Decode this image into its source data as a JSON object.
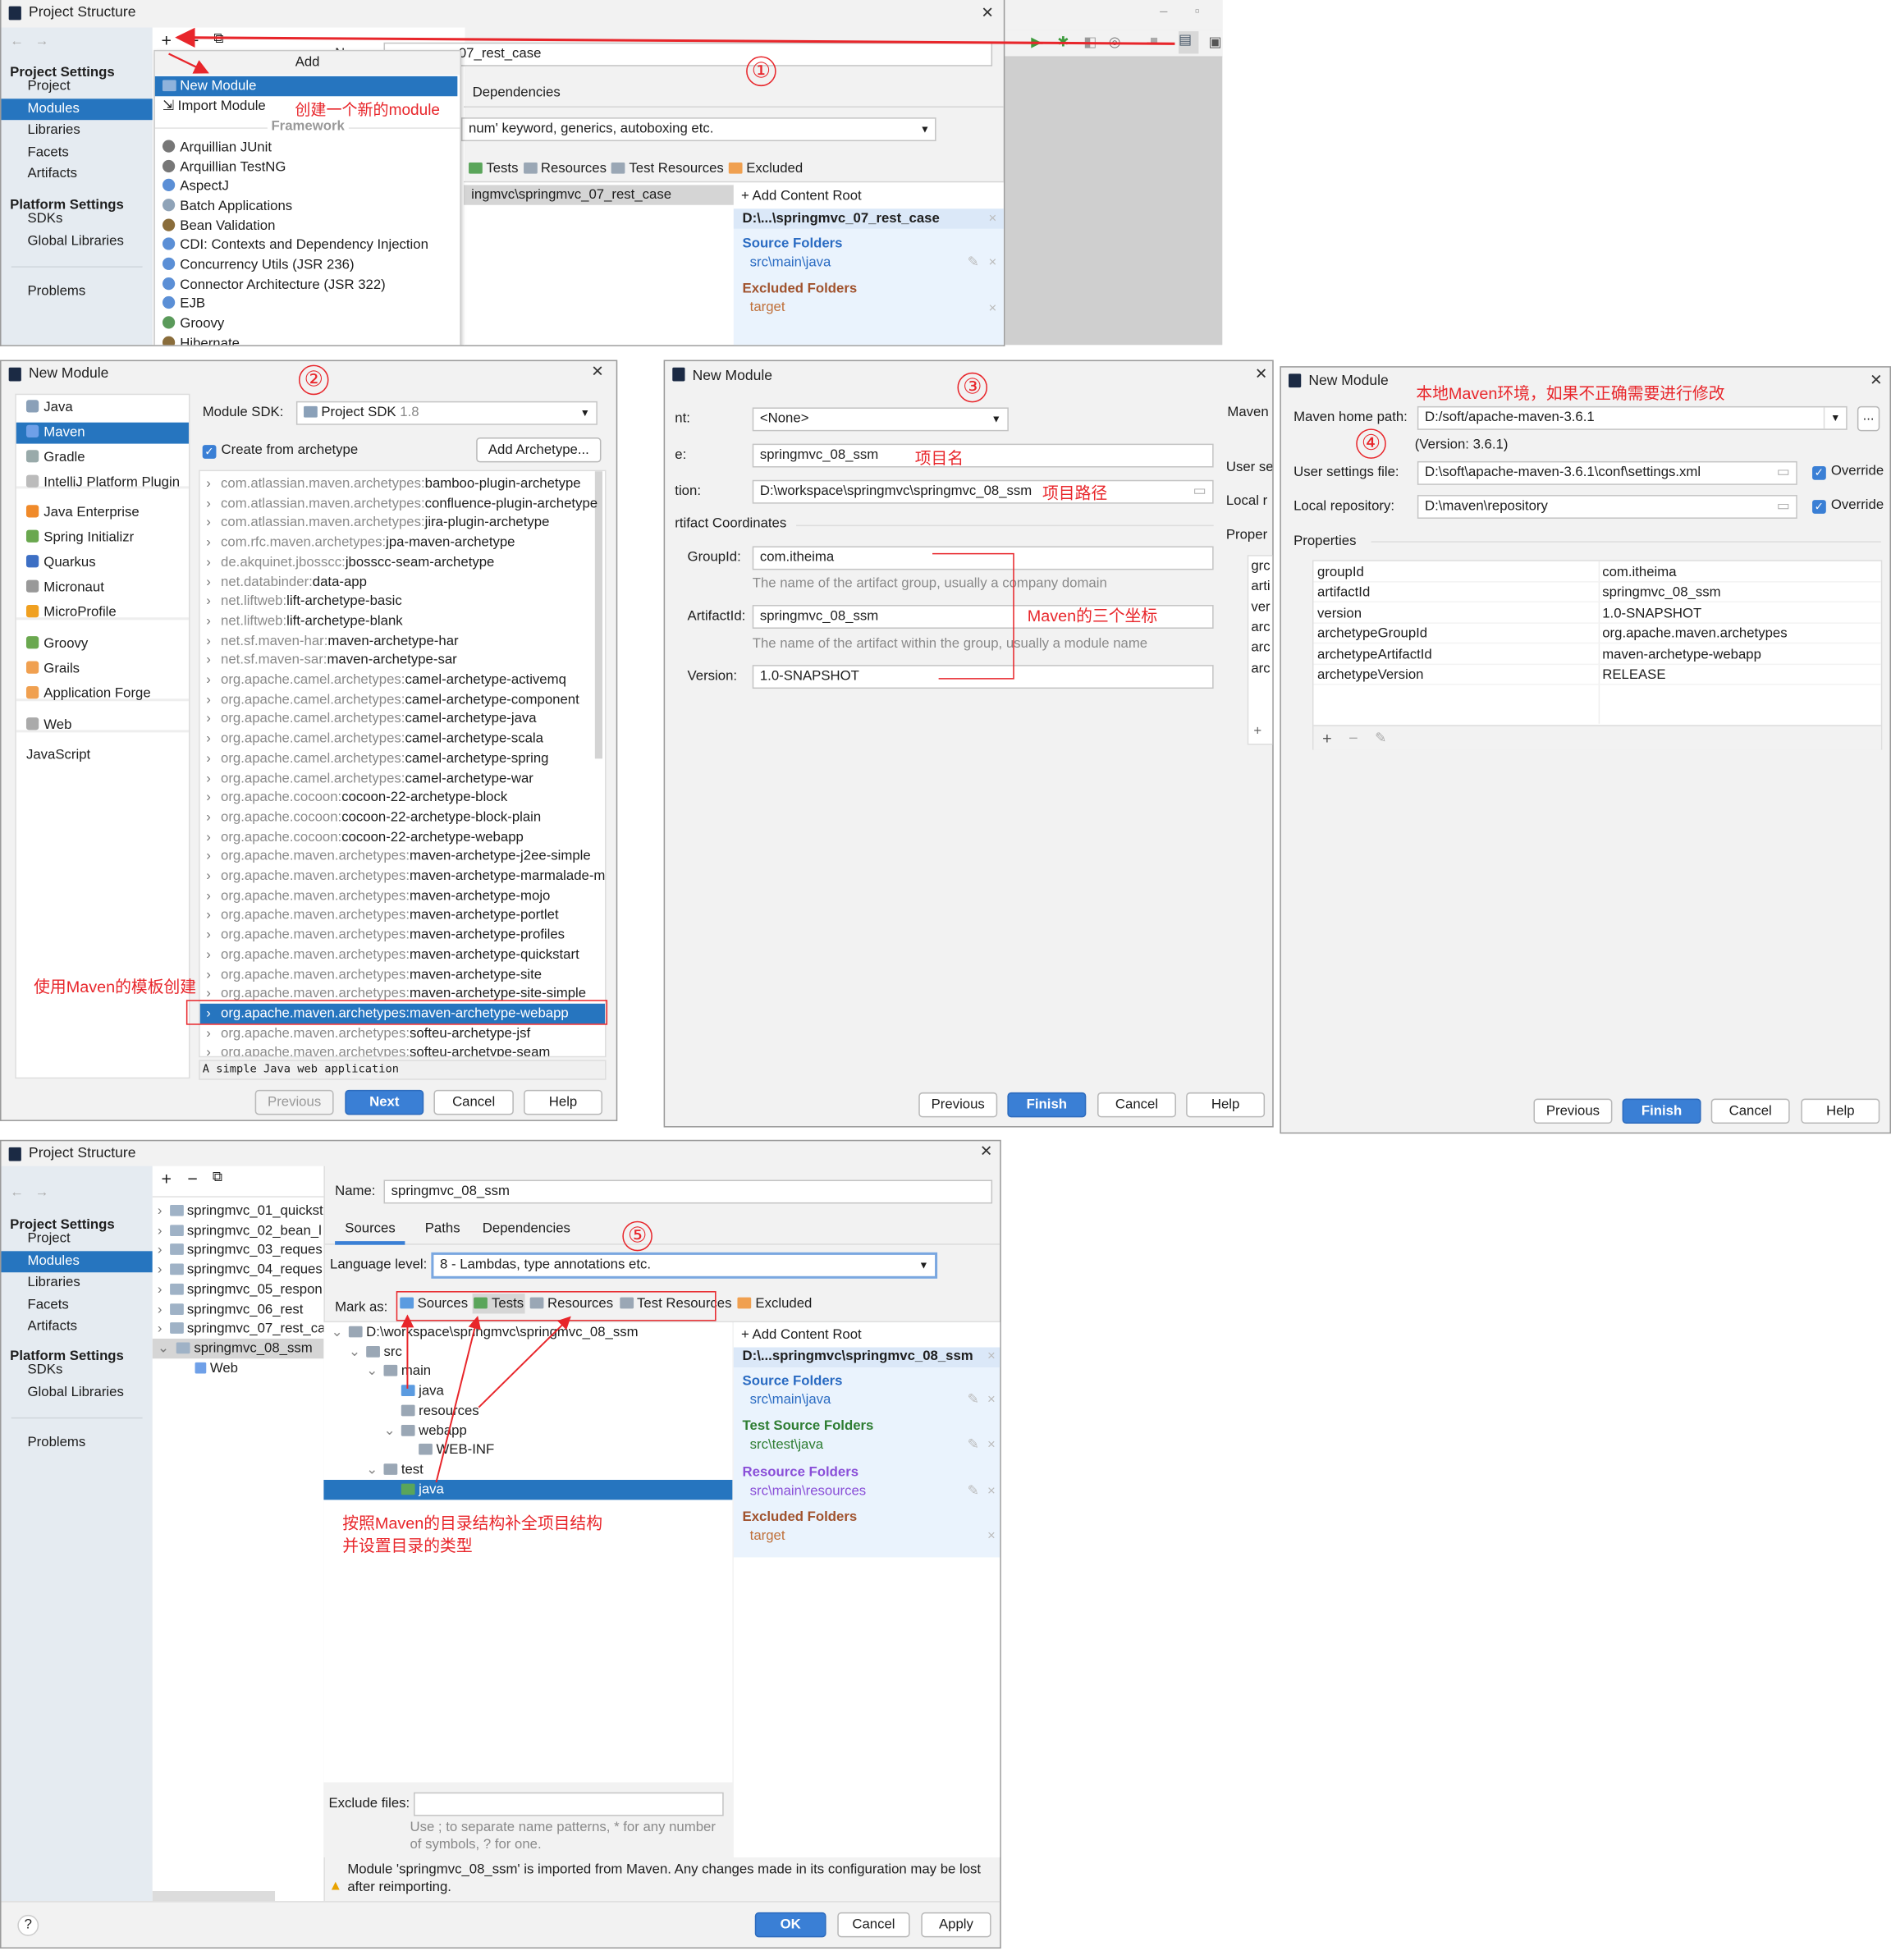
{
  "colors": {
    "selection": "#2675bf",
    "annotation": "#e8262b",
    "source": "#2a6bc2",
    "test": "#2e7d32",
    "resource": "#8a4fd8",
    "excluded": "#a0522d"
  },
  "sidebar": {
    "project_settings": "Project Settings",
    "items": [
      "Project",
      "Modules",
      "Libraries",
      "Facets",
      "Artifacts"
    ],
    "platform_settings": "Platform Settings",
    "platform_items": [
      "SDKs",
      "Global Libraries"
    ],
    "problems": "Problems"
  },
  "p1": {
    "title": "Project Structure",
    "step": "①",
    "name_value": "07_rest_case",
    "add_popup": {
      "header": "Add",
      "new_module": "New Module",
      "import_module": "Import Module",
      "framework": "Framework",
      "items": [
        "Arquillian JUnit",
        "Arquillian TestNG",
        "AspectJ",
        "Batch Applications",
        "Bean Validation",
        "CDI: Contexts and Dependency Injection",
        "Concurrency Utils (JSR 236)",
        "Connector Architecture (JSR 322)",
        "EJB",
        "Groovy",
        "Hibernate"
      ]
    },
    "annotation": "创建一个新的module",
    "dependencies_tab": "Dependencies",
    "language_level": "num' keyword, generics, autoboxing etc.",
    "mark_as": [
      "Tests",
      "Resources",
      "Test Resources",
      "Excluded"
    ],
    "tree_row": "ingmvc\\springmvc_07_rest_case",
    "content": {
      "add": "Add Content Root",
      "root": "D:\\...\\springmvc_07_rest_case",
      "source_folders": "Source Folders",
      "source_path": "src\\main\\java",
      "excluded_folders": "Excluded Folders",
      "excluded_path": "target"
    }
  },
  "p2": {
    "title": "New Module",
    "step": "②",
    "types": [
      "Java",
      "Maven",
      "Gradle",
      "IntelliJ Platform Plugin",
      "Java Enterprise",
      "Spring Initializr",
      "Quarkus",
      "Micronaut",
      "MicroProfile",
      "Groovy",
      "Grails",
      "Application Forge",
      "Web",
      "JavaScript"
    ],
    "sdk_label": "Module SDK:",
    "sdk_value": "Project SDK",
    "sdk_version": "1.8",
    "create_from_archetype": "Create from archetype",
    "add_archetype": "Add Archetype...",
    "archetypes": [
      [
        "com.atlassian.maven.archetypes:",
        "bamboo-plugin-archetype"
      ],
      [
        "com.atlassian.maven.archetypes:",
        "confluence-plugin-archetype"
      ],
      [
        "com.atlassian.maven.archetypes:",
        "jira-plugin-archetype"
      ],
      [
        "com.rfc.maven.archetypes:",
        "jpa-maven-archetype"
      ],
      [
        "de.akquinet.jbosscc:",
        "jbosscc-seam-archetype"
      ],
      [
        "net.databinder:",
        "data-app"
      ],
      [
        "net.liftweb:",
        "lift-archetype-basic"
      ],
      [
        "net.liftweb:",
        "lift-archetype-blank"
      ],
      [
        "net.sf.maven-har:",
        "maven-archetype-har"
      ],
      [
        "net.sf.maven-sar:",
        "maven-archetype-sar"
      ],
      [
        "org.apache.camel.archetypes:",
        "camel-archetype-activemq"
      ],
      [
        "org.apache.camel.archetypes:",
        "camel-archetype-component"
      ],
      [
        "org.apache.camel.archetypes:",
        "camel-archetype-java"
      ],
      [
        "org.apache.camel.archetypes:",
        "camel-archetype-scala"
      ],
      [
        "org.apache.camel.archetypes:",
        "camel-archetype-spring"
      ],
      [
        "org.apache.camel.archetypes:",
        "camel-archetype-war"
      ],
      [
        "org.apache.cocoon:",
        "cocoon-22-archetype-block"
      ],
      [
        "org.apache.cocoon:",
        "cocoon-22-archetype-block-plain"
      ],
      [
        "org.apache.cocoon:",
        "cocoon-22-archetype-webapp"
      ],
      [
        "org.apache.maven.archetypes:",
        "maven-archetype-j2ee-simple"
      ],
      [
        "org.apache.maven.archetypes:",
        "maven-archetype-marmalade-mo"
      ],
      [
        "org.apache.maven.archetypes:",
        "maven-archetype-mojo"
      ],
      [
        "org.apache.maven.archetypes:",
        "maven-archetype-portlet"
      ],
      [
        "org.apache.maven.archetypes:",
        "maven-archetype-profiles"
      ],
      [
        "org.apache.maven.archetypes:",
        "maven-archetype-quickstart"
      ],
      [
        "org.apache.maven.archetypes:",
        "maven-archetype-site"
      ],
      [
        "org.apache.maven.archetypes:",
        "maven-archetype-site-simple"
      ],
      [
        "org.apache.maven.archetypes:",
        "maven-archetype-webapp"
      ],
      [
        "org.apache.maven.archetypes:",
        "softeu-archetype-jsf"
      ],
      [
        "org.apache.maven.archetypes:",
        "softeu-archetype-seam"
      ]
    ],
    "selected_archetype": "maven-archetype-webapp",
    "description": "A simple Java web application",
    "annotation": "使用Maven的模板创建",
    "buttons": {
      "previous": "Previous",
      "next": "Next",
      "cancel": "Cancel",
      "help": "Help"
    }
  },
  "p3": {
    "title": "New Module",
    "step": "③",
    "parent_label": "nt:",
    "parent_value": "<None>",
    "name_label": "e:",
    "name_value": "springmvc_08_ssm",
    "name_note": "项目名",
    "location_label": "tion:",
    "location_value": "D:\\workspace\\springmvc\\springmvc_08_ssm",
    "location_note": "项目路径",
    "section": "rtifact Coordinates",
    "groupid_label": "GroupId:",
    "groupid_value": "com.itheima",
    "groupid_hint": "The name of the artifact group, usually a company domain",
    "artifactid_label": "ArtifactId:",
    "artifactid_value": "springmvc_08_ssm",
    "artifactid_hint": "The name of the artifact within the group, usually a module name",
    "version_label": "Version:",
    "version_value": "1.0-SNAPSHOT",
    "coords_note": "Maven的三个坐标",
    "behind": {
      "maven": "Maven",
      "user": "User se",
      "local": "Local r",
      "props": "Proper",
      "rows": [
        "grc",
        "arti",
        "ver",
        "arc",
        "arc",
        "arc"
      ]
    },
    "buttons": {
      "previous": "Previous",
      "finish": "Finish",
      "cancel": "Cancel",
      "help": "Help"
    }
  },
  "p4": {
    "title": "New Module",
    "step": "④",
    "annotation": "本地Maven环境，如果不正确需要进行修改",
    "home_label": "Maven home path:",
    "home_value": "D:/soft/apache-maven-3.6.1",
    "browse": "...",
    "version": "(Version: 3.6.1)",
    "settings_label": "User settings file:",
    "settings_value": "D:\\soft\\apache-maven-3.6.1\\conf\\settings.xml",
    "repo_label": "Local repository:",
    "repo_value": "D:\\maven\\repository",
    "override": "Override",
    "properties": "Properties",
    "props": [
      [
        "groupId",
        "com.itheima"
      ],
      [
        "artifactId",
        "springmvc_08_ssm"
      ],
      [
        "version",
        "1.0-SNAPSHOT"
      ],
      [
        "archetypeGroupId",
        "org.apache.maven.archetypes"
      ],
      [
        "archetypeArtifactId",
        "maven-archetype-webapp"
      ],
      [
        "archetypeVersion",
        "RELEASE"
      ]
    ],
    "buttons": {
      "previous": "Previous",
      "finish": "Finish",
      "cancel": "Cancel",
      "help": "Help"
    }
  },
  "p5": {
    "title": "Project Structure",
    "step": "⑤",
    "modules": [
      "springmvc_01_quickst",
      "springmvc_02_bean_l",
      "springmvc_03_reques",
      "springmvc_04_reques",
      "springmvc_05_respon",
      "springmvc_06_rest",
      "springmvc_07_rest_ca",
      "springmvc_08_ssm"
    ],
    "web_facet": "Web",
    "name_label": "Name:",
    "name_value": "springmvc_08_ssm",
    "tabs": [
      "Sources",
      "Paths",
      "Dependencies"
    ],
    "language_label": "Language level:",
    "language_value": "8 - Lambdas, type annotations etc.",
    "mark_label": "Mark as:",
    "mark_as": [
      "Sources",
      "Tests",
      "Resources",
      "Test Resources",
      "Excluded"
    ],
    "tree": [
      [
        "D:\\workspace\\springmvc\\springmvc_08_ssm",
        0,
        "v"
      ],
      [
        "src",
        1,
        "v"
      ],
      [
        "main",
        2,
        "v"
      ],
      [
        "java",
        3,
        ""
      ],
      [
        "resources",
        3,
        ""
      ],
      [
        "webapp",
        3,
        "v"
      ],
      [
        "WEB-INF",
        4,
        ""
      ],
      [
        "test",
        2,
        "v"
      ],
      [
        "java",
        3,
        ""
      ]
    ],
    "annotation_1": "按照Maven的目录结构补全项目结构",
    "annotation_2": "并设置目录的类型",
    "content": {
      "add": "Add Content Root",
      "root": "D:\\...springmvc\\springmvc_08_ssm",
      "source_folders": "Source Folders",
      "source_path": "src\\main\\java",
      "test_folders": "Test Source Folders",
      "test_path": "src\\test\\java",
      "resource_folders": "Resource Folders",
      "resource_path": "src\\main\\resources",
      "excluded_folders": "Excluded Folders",
      "excluded_path": "target"
    },
    "exclude_label": "Exclude files:",
    "exclude_value": "",
    "exclude_hint_1": "Use ; to separate name patterns, * for any number",
    "exclude_hint_2": "of symbols, ? for one.",
    "warning": "Module 'springmvc_08_ssm' is imported from Maven. Any changes made in its configuration may be lost",
    "warning_2": "after reimporting.",
    "help": "?",
    "buttons": {
      "ok": "OK",
      "cancel": "Cancel",
      "apply": "Apply"
    }
  }
}
